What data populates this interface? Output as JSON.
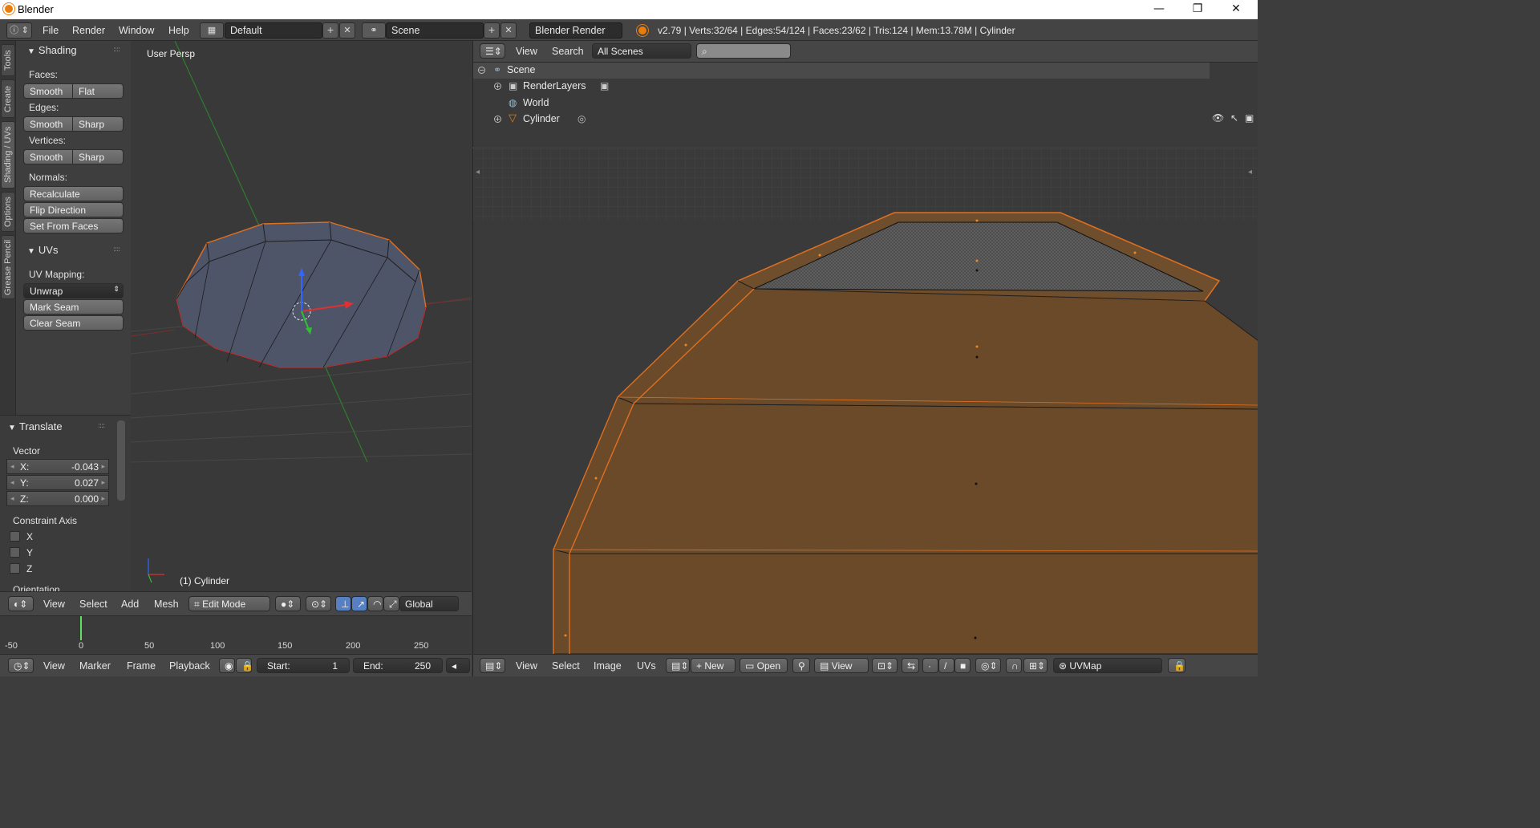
{
  "window": {
    "title": "Blender",
    "min": "—",
    "max": "❐",
    "close": "✕"
  },
  "info": {
    "menus": [
      "File",
      "Render",
      "Window",
      "Help"
    ],
    "layout": "Default",
    "scene": "Scene",
    "engine": "Blender Render",
    "stats": "v2.79 | Verts:32/64 | Edges:54/124 | Faces:23/62 | Tris:124 | Mem:13.78M | Cylinder"
  },
  "tabs": [
    "Tools",
    "Create",
    "Shading / UVs",
    "Options",
    "Grease Pencil"
  ],
  "shading": {
    "title": "Shading",
    "faces_label": "Faces:",
    "edges_label": "Edges:",
    "vertices_label": "Vertices:",
    "normals_label": "Normals:",
    "smooth": "Smooth",
    "flat": "Flat",
    "sharp": "Sharp",
    "recalculate": "Recalculate",
    "flip": "Flip Direction",
    "set_from_faces": "Set From Faces"
  },
  "uvs": {
    "title": "UVs",
    "mapping_label": "UV Mapping:",
    "unwrap": "Unwrap",
    "mark_seam": "Mark Seam",
    "clear_seam": "Clear Seam"
  },
  "translate": {
    "title": "Translate",
    "vector_label": "Vector",
    "x_key": "X:",
    "x": "-0.043",
    "y_key": "Y:",
    "y": "0.027",
    "z_key": "Z:",
    "z": "0.000",
    "constraint_label": "Constraint Axis",
    "cx": "X",
    "cy": "Y",
    "cz": "Z",
    "orientation_label": "Orientation"
  },
  "viewport": {
    "persp": "User Persp",
    "object": "(1) Cylinder"
  },
  "vp_header": {
    "menus": [
      "View",
      "Select",
      "Add",
      "Mesh"
    ],
    "mode": "Edit Mode",
    "orientation": "Global"
  },
  "timeline": {
    "ticks": [
      "-50",
      "0",
      "50",
      "100",
      "150",
      "200",
      "250"
    ],
    "menus": [
      "View",
      "Marker",
      "Frame",
      "Playback"
    ],
    "start_label": "Start:",
    "start": "1",
    "end_label": "End:",
    "end": "250"
  },
  "outliner": {
    "menus": [
      "View",
      "Search"
    ],
    "filter": "All Scenes",
    "items": [
      "Scene",
      "RenderLayers",
      "World",
      "Cylinder"
    ]
  },
  "uv_header": {
    "menus": [
      "View",
      "Select",
      "Image",
      "UVs"
    ],
    "new": "New",
    "open": "Open",
    "view": "View",
    "uvmap": "UVMap"
  },
  "colors": {
    "accent": "#e87d0d",
    "mesh_face": "#6b4a2a",
    "grid_bg": "#393939"
  }
}
